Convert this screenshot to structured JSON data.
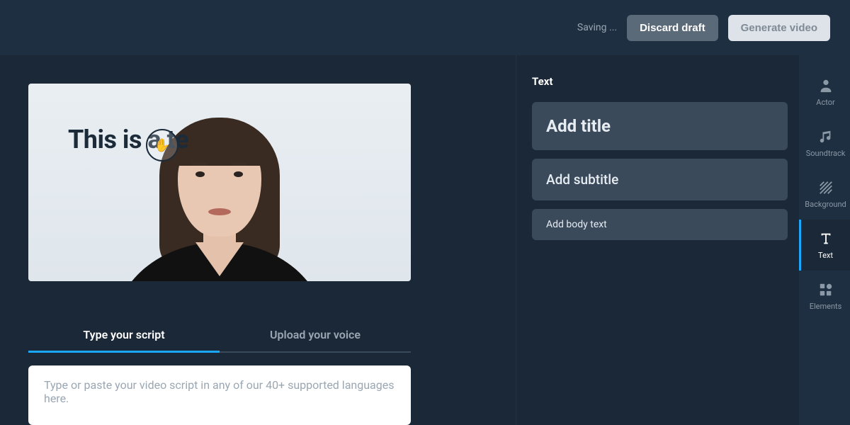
{
  "topbar": {
    "saving_label": "Saving ...",
    "discard_label": "Discard draft",
    "generate_label": "Generate video"
  },
  "canvas": {
    "overlay_text": "This is a te",
    "cursor_glyph": "✋"
  },
  "script": {
    "tab_type_label": "Type your script",
    "tab_upload_label": "Upload your voice",
    "placeholder": "Type or paste your video script in any of our 40+ supported languages here."
  },
  "text_panel": {
    "heading": "Text",
    "add_title": "Add title",
    "add_subtitle": "Add subtitle",
    "add_body": "Add body text"
  },
  "tools": {
    "actor": "Actor",
    "soundtrack": "Soundtrack",
    "background": "Background",
    "text": "Text",
    "elements": "Elements"
  }
}
